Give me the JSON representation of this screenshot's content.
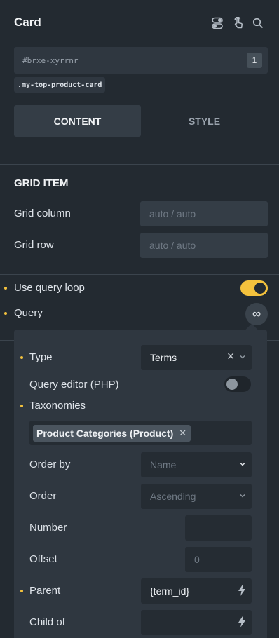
{
  "header": {
    "title": "Card",
    "icons": [
      "toggle-icon",
      "hand-pointer-icon",
      "search-icon"
    ]
  },
  "element": {
    "id": "#brxe-xyrrnr",
    "id_count": "1",
    "class": ".my-top-product-card"
  },
  "tabs": {
    "content": "CONTENT",
    "style": "STYLE"
  },
  "grid_item": {
    "title": "GRID ITEM",
    "column_label": "Grid column",
    "column_placeholder": "auto / auto",
    "row_label": "Grid row",
    "row_placeholder": "auto / auto"
  },
  "query_loop": {
    "use_label": "Use query loop",
    "use_enabled": true,
    "query_label": "Query",
    "query_icon": "infinity-icon"
  },
  "query_panel": {
    "type_label": "Type",
    "type_value": "Terms",
    "editor_label": "Query editor (PHP)",
    "editor_enabled": false,
    "taxonomies_label": "Taxonomies",
    "taxonomy_chip": "Product Categories (Product)",
    "order_by_label": "Order by",
    "order_by_placeholder": "Name",
    "order_label": "Order",
    "order_placeholder": "Ascending",
    "number_label": "Number",
    "number_value": "",
    "offset_label": "Offset",
    "offset_placeholder": "0",
    "parent_label": "Parent",
    "parent_value": "{term_id}",
    "child_of_label": "Child of",
    "child_of_value": ""
  },
  "colors": {
    "background": "#232a31",
    "field": "#343d46",
    "accent": "#f4c23d"
  }
}
